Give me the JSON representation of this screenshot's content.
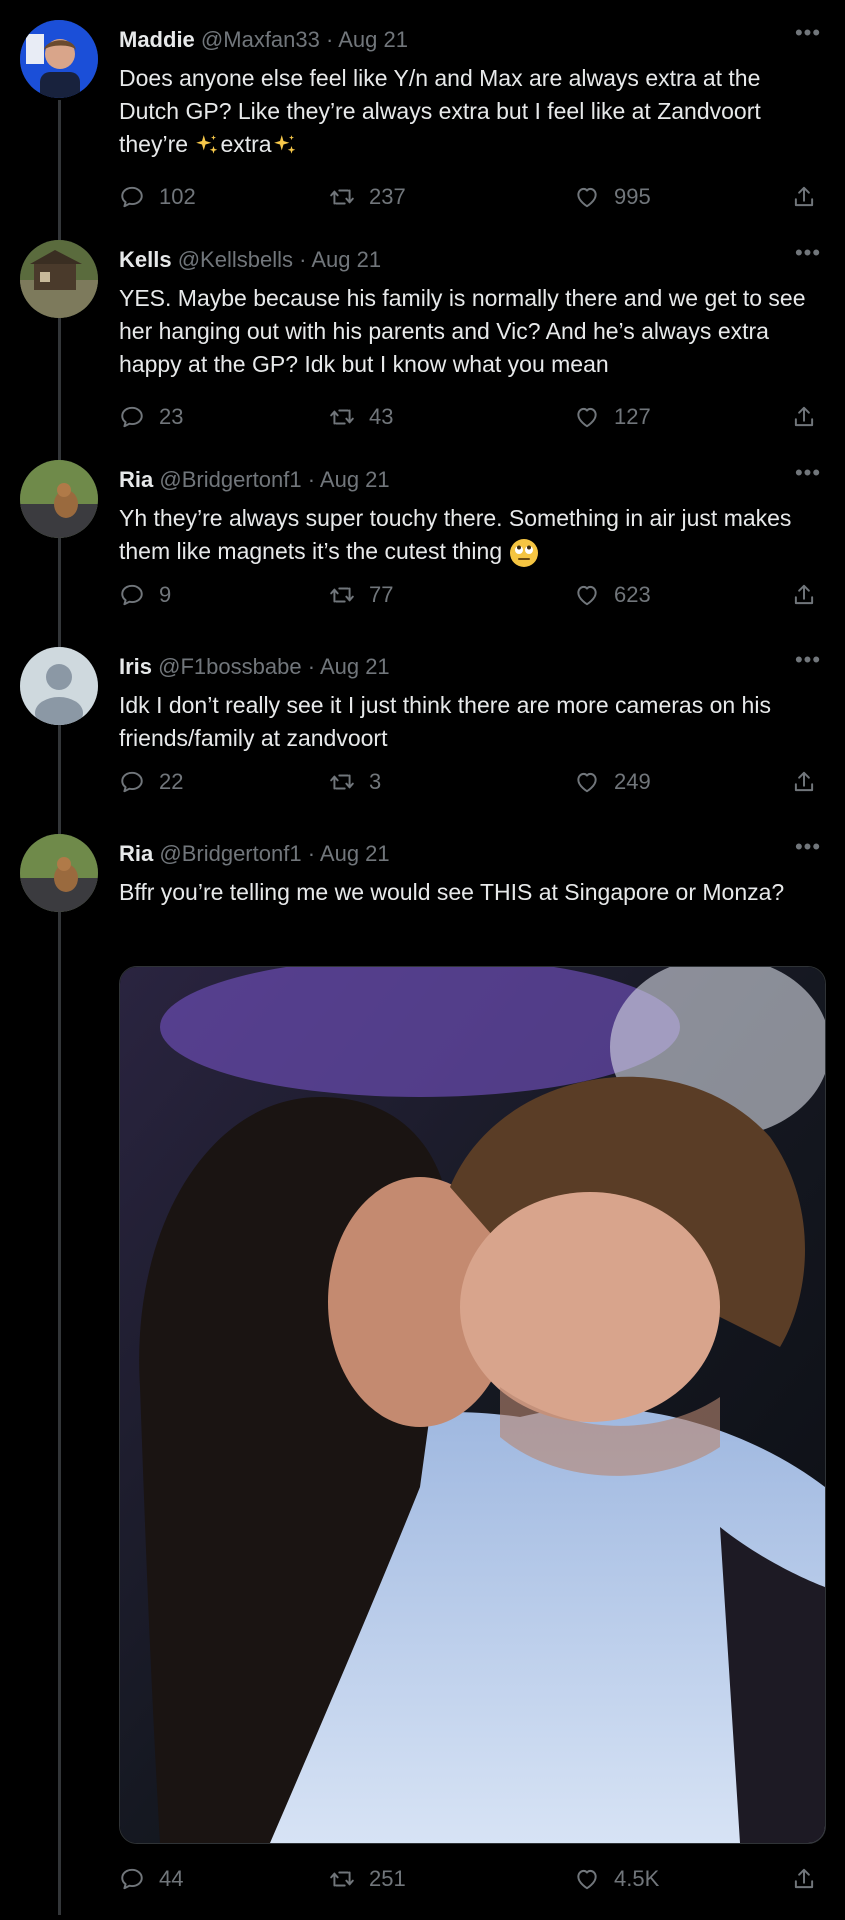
{
  "tweets": [
    {
      "name": "Maddie",
      "handle": "@Maxfan33",
      "date": "Aug 21",
      "text_a": "Does anyone else feel like Y/n and Max are always extra at the Dutch GP? Like they’re always extra but I feel like at Zandvoort they’re ",
      "text_b": "extra",
      "replies": "102",
      "retweets": "237",
      "likes": "995"
    },
    {
      "name": "Kells",
      "handle": "@Kellsbells",
      "date": "Aug 21",
      "text": "YES. Maybe because his family is normally there and we get to see her hanging out with his parents and Vic? And he’s always extra happy at the GP? Idk but I know what you mean",
      "replies": "23",
      "retweets": "43",
      "likes": "127"
    },
    {
      "name": "Ria",
      "handle": "@Bridgertonf1",
      "date": "Aug 21",
      "text": "Yh they’re always super touchy there. Something in air just makes them like magnets it’s the cutest thing",
      "replies": "9",
      "retweets": "77",
      "likes": "623"
    },
    {
      "name": "Iris",
      "handle": "@F1bossbabe",
      "date": "Aug 21",
      "text": "Idk I don’t really see it I just think there are more cameras on his friends/family at zandvoort",
      "replies": "22",
      "retweets": "3",
      "likes": "249"
    },
    {
      "name": "Ria",
      "handle": "@Bridgertonf1",
      "date": "Aug 21",
      "text": "Bffr you’re telling me we would see THIS at Singapore or Monza?",
      "replies": "44",
      "retweets": "251",
      "likes": "4.5K"
    }
  ],
  "separator": "·",
  "more_glyph": "•••",
  "colors": {
    "background": "#000000",
    "text": "#e7e9ea",
    "muted": "#71767b",
    "thread_line": "#333639"
  },
  "icons": [
    "reply-icon",
    "retweet-icon",
    "like-icon",
    "share-icon",
    "more-icon",
    "sparkles-emoji",
    "rolling-eyes-emoji"
  ]
}
